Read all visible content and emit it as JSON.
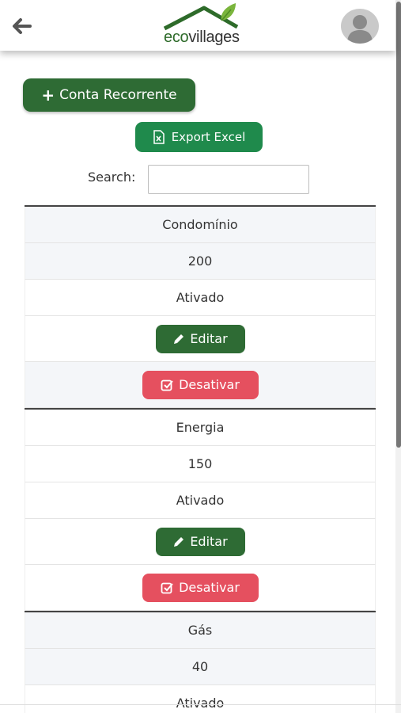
{
  "header": {
    "logo_prefix": "eco",
    "logo_suffix": "villages"
  },
  "actions": {
    "add_recurring_label": "Conta Recorrente",
    "export_label": "Export Excel"
  },
  "search": {
    "label": "Search:",
    "value": "",
    "placeholder": ""
  },
  "records": [
    {
      "name": "Condomínio",
      "value": "200",
      "status": "Ativado",
      "edit_label": "Editar",
      "deactivate_label": "Desativar"
    },
    {
      "name": "Energia",
      "value": "150",
      "status": "Ativado",
      "edit_label": "Editar",
      "deactivate_label": "Desativar"
    },
    {
      "name": "Gás",
      "value": "40",
      "status": "Ativado"
    }
  ],
  "colors": {
    "primary_green": "#2e6b34",
    "export_green": "#1f8a4c",
    "danger_red": "#e5505f"
  }
}
